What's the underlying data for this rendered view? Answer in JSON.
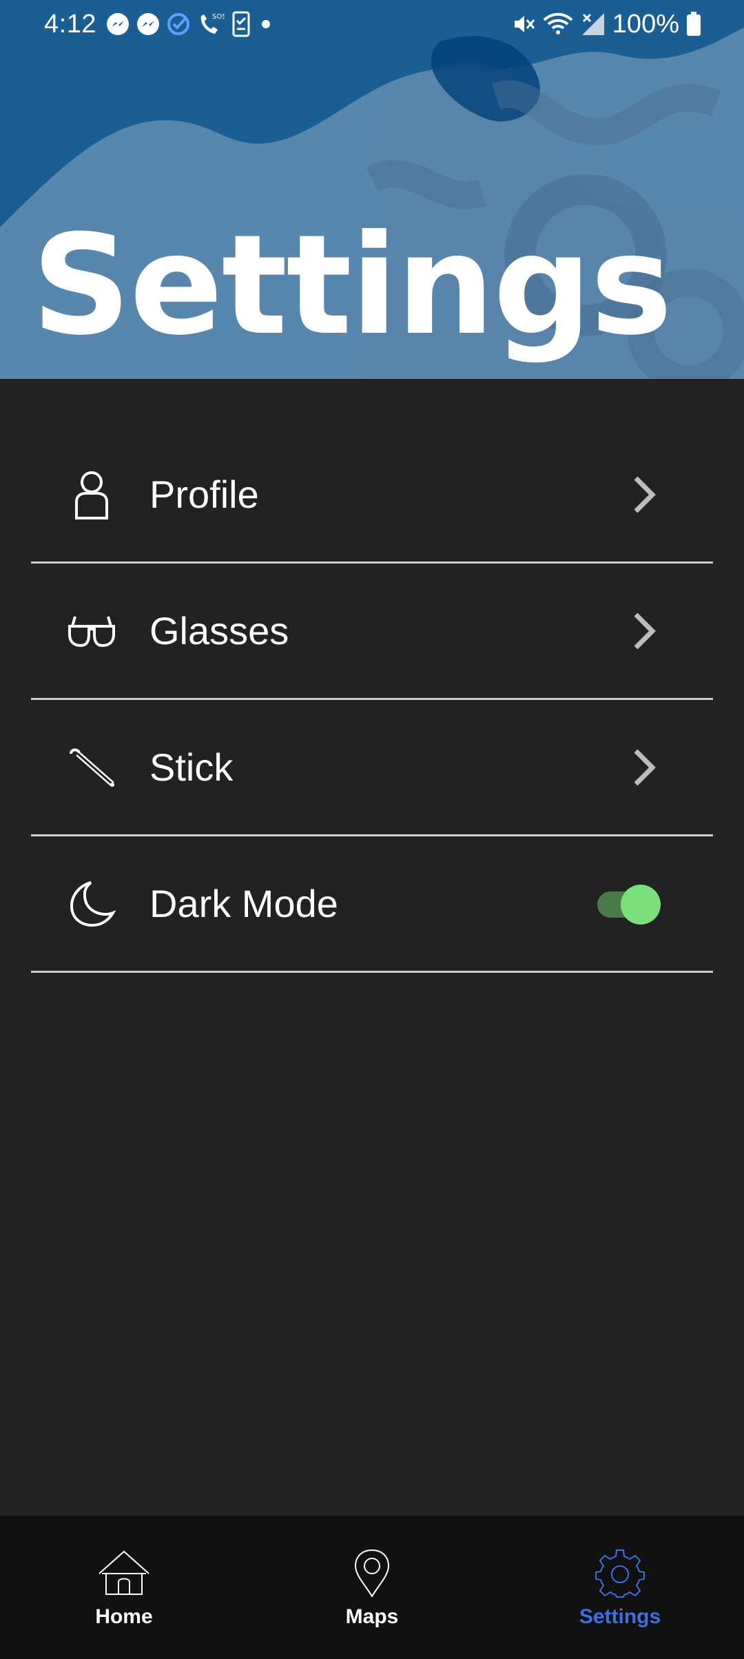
{
  "status_bar": {
    "time": "4:12",
    "battery_percent": "100%",
    "icons": [
      "messenger-icon",
      "messenger-icon",
      "check-circle-icon",
      "sos-call-icon",
      "phone-checklist-icon",
      "dot-icon",
      "mute-icon",
      "wifi-icon",
      "no-signal-icon",
      "battery-icon"
    ]
  },
  "header": {
    "title": "Settings",
    "background_color": "#1a5e94"
  },
  "settings": {
    "items": [
      {
        "label": "Profile",
        "icon": "person-icon",
        "control": "chevron-right-icon"
      },
      {
        "label": "Glasses",
        "icon": "glasses-icon",
        "control": "chevron-right-icon"
      },
      {
        "label": "Stick",
        "icon": "cane-icon",
        "control": "chevron-right-icon"
      },
      {
        "label": "Dark Mode",
        "icon": "moon-icon",
        "control": "toggle",
        "toggle_on": true
      }
    ]
  },
  "bottom_nav": {
    "items": [
      {
        "label": "Home",
        "icon": "home-icon",
        "active": false
      },
      {
        "label": "Maps",
        "icon": "map-pin-icon",
        "active": false
      },
      {
        "label": "Settings",
        "icon": "gear-icon",
        "active": true
      }
    ],
    "active_color": "#3d6fe0"
  },
  "colors": {
    "background": "#222222",
    "divider": "#cfcfcf",
    "toggle_on": "#7be07b",
    "nav_background": "#111111"
  }
}
